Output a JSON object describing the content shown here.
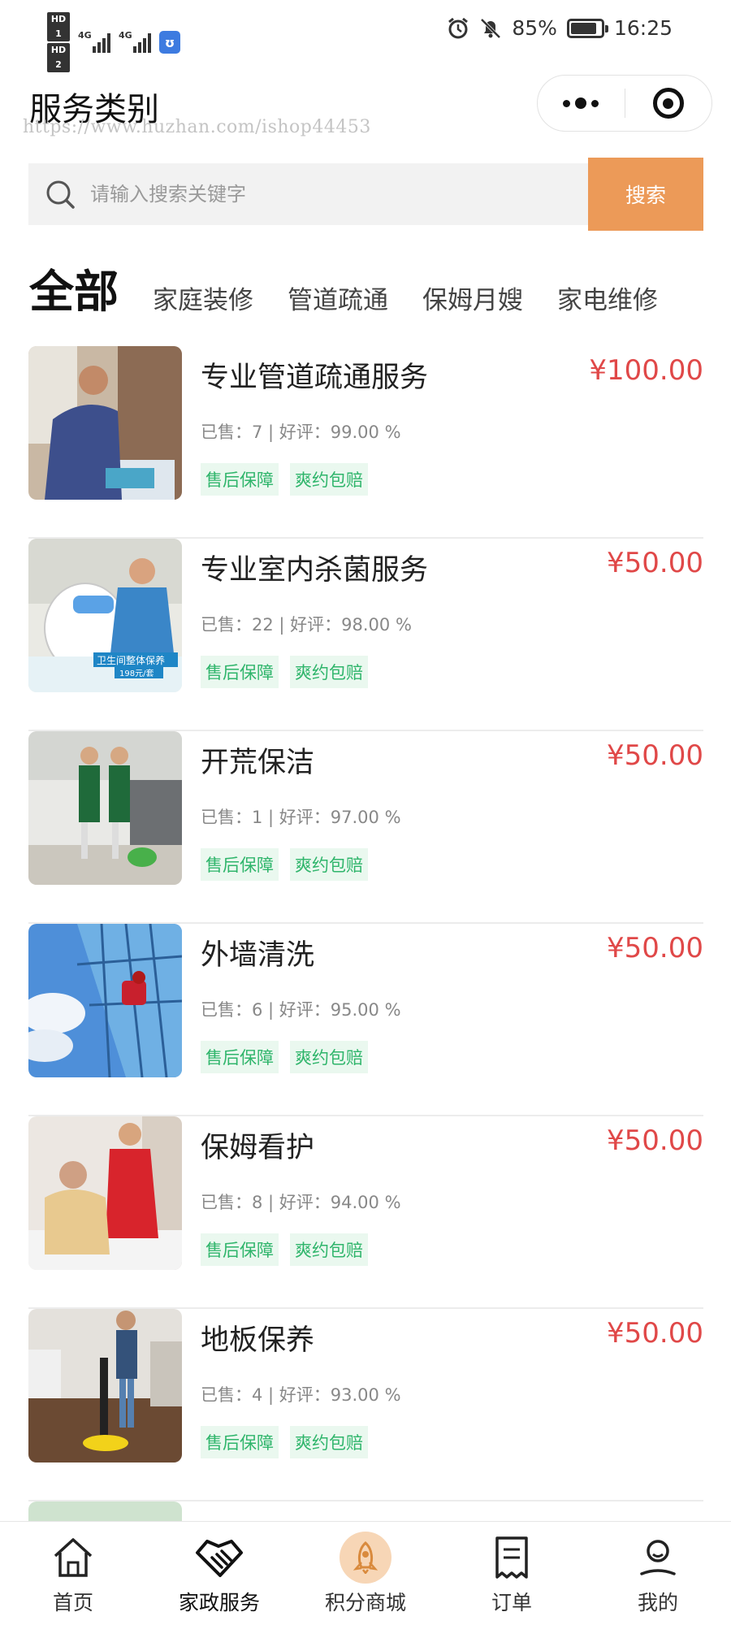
{
  "status_bar": {
    "hd1": "HD 1",
    "hd2": "HD 2",
    "net1": "4G",
    "net2": "4G",
    "battery": "85%",
    "battery_level": 0.85,
    "time": "16:25",
    "icons": [
      "alarm-icon",
      "mute-icon",
      "battery-icon"
    ]
  },
  "header": {
    "title": "服务类别",
    "watermark": "https://www.huzhan.com/ishop44453"
  },
  "search": {
    "placeholder": "请输入搜索关键字",
    "value": "",
    "button_label": "搜索"
  },
  "tabs": [
    {
      "label": "全部",
      "active": true
    },
    {
      "label": "家庭装修",
      "active": false
    },
    {
      "label": "管道疏通",
      "active": false
    },
    {
      "label": "保姆月嫂",
      "active": false
    },
    {
      "label": "家电维修",
      "active": false
    }
  ],
  "services": [
    {
      "name": "专业管道疏通服务",
      "price": "¥100.00",
      "stats": "已售：7 | 好评：99.00 %",
      "tags": [
        "售后保障",
        "爽约包赔"
      ]
    },
    {
      "name": "专业室内杀菌服务",
      "price": "¥50.00",
      "stats": "已售：22 | 好评：98.00 %",
      "tags": [
        "售后保障",
        "爽约包赔"
      ],
      "image_text": [
        "卫生间整体保养",
        "198元/套"
      ]
    },
    {
      "name": "开荒保洁",
      "price": "¥50.00",
      "stats": "已售：1 | 好评：97.00 %",
      "tags": [
        "售后保障",
        "爽约包赔"
      ]
    },
    {
      "name": "外墙清洗",
      "price": "¥50.00",
      "stats": "已售：6 | 好评：95.00 %",
      "tags": [
        "售后保障",
        "爽约包赔"
      ]
    },
    {
      "name": "保姆看护",
      "price": "¥50.00",
      "stats": "已售：8 | 好评：94.00 %",
      "tags": [
        "售后保障",
        "爽约包赔"
      ]
    },
    {
      "name": "地板保养",
      "price": "¥50.00",
      "stats": "已售：4 | 好评：93.00 %",
      "tags": [
        "售后保障",
        "爽约包赔"
      ]
    }
  ],
  "bottom_nav": [
    {
      "label": "首页",
      "icon": "home-icon",
      "active": false
    },
    {
      "label": "家政服务",
      "icon": "handshake-icon",
      "active": true
    },
    {
      "label": "积分商城",
      "icon": "rocket-icon",
      "active": false
    },
    {
      "label": "订单",
      "icon": "receipt-icon",
      "active": false
    },
    {
      "label": "我的",
      "icon": "user-icon",
      "active": false
    }
  ],
  "colors": {
    "accent": "#ec9a58",
    "price": "#e04848",
    "tag_text": "#2fb56b",
    "tag_bg": "#eaf8ef"
  }
}
